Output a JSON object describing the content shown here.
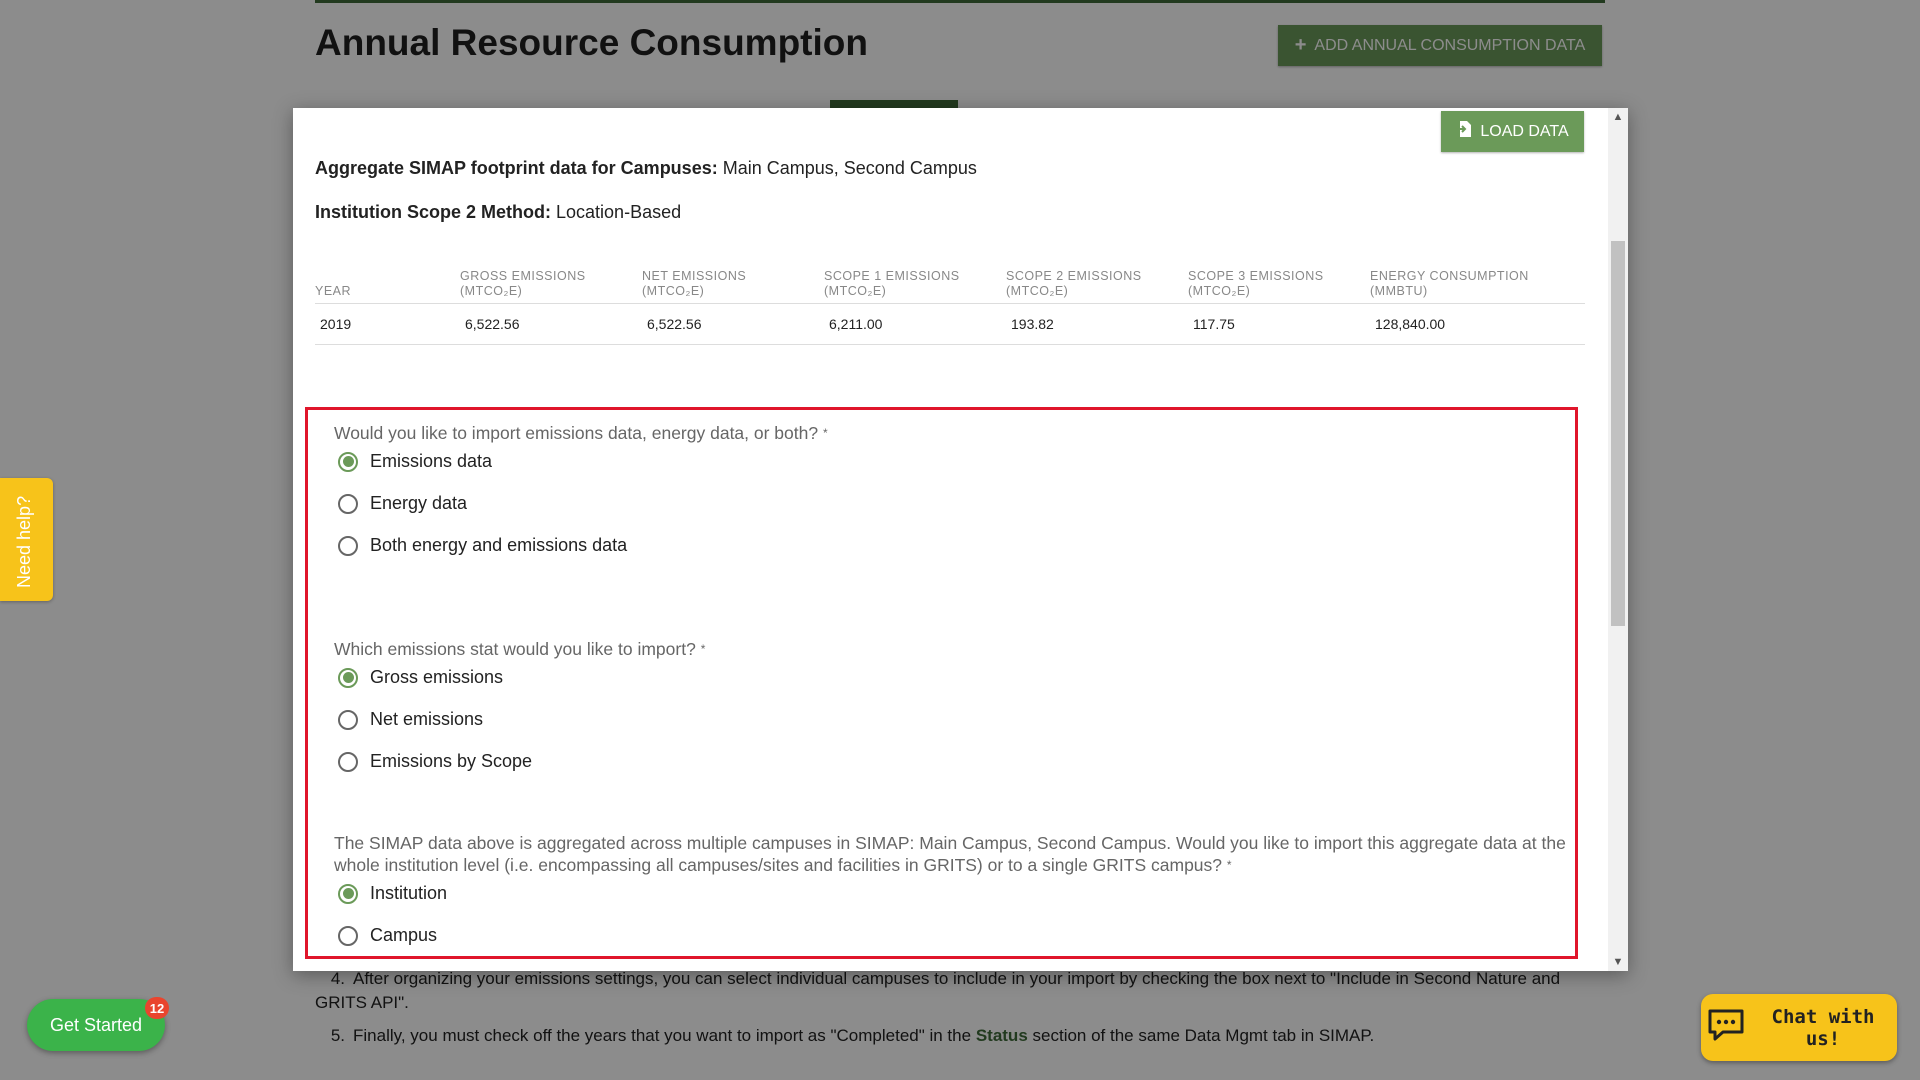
{
  "page": {
    "title": "Annual Resource Consumption",
    "add_button_label": "ADD ANNUAL CONSUMPTION DATA",
    "steps": [
      {
        "num": "4.",
        "text": "After organizing your emissions settings, you can select individual campuses to include in your import by checking the box next to \"Include in Second Nature and GRITS API\"."
      },
      {
        "num": "5.",
        "text_before": "Finally, you must check off the years that you want to import as \"Completed\" in the",
        "link": "Status",
        "text_after": "section of the same Data Mgmt tab in SIMAP."
      }
    ]
  },
  "widgets": {
    "need_help": "Need help?",
    "get_started": "Get Started",
    "get_started_badge": "12",
    "chat": "Chat with us!"
  },
  "modal": {
    "load_button_label": "LOAD DATA",
    "aggregate_label": "Aggregate SIMAP footprint data for Campuses:",
    "aggregate_value": "Main Campus, Second Campus",
    "scope2_label": "Institution Scope 2 Method:",
    "scope2_value": "Location-Based",
    "table": {
      "headers": [
        {
          "line1": "",
          "line2": "YEAR"
        },
        {
          "line1": "GROSS EMISSIONS",
          "line2": "(MTCO₂E)"
        },
        {
          "line1": "NET EMISSIONS",
          "line2": "(MTCO₂E)"
        },
        {
          "line1": "SCOPE 1 EMISSIONS",
          "line2": "(MTCO₂E)"
        },
        {
          "line1": "SCOPE 2 EMISSIONS",
          "line2": "(MTCO₂E)"
        },
        {
          "line1": "SCOPE 3 EMISSIONS",
          "line2": "(MTCO₂E)"
        },
        {
          "line1": "ENERGY CONSUMPTION",
          "line2": "(MMBTU)"
        }
      ],
      "rows": [
        [
          "2019",
          "6,522.56",
          "6,522.56",
          "6,211.00",
          "193.82",
          "117.75",
          "128,840.00"
        ]
      ]
    },
    "questions": [
      {
        "text": "Would you like to import emissions data, energy data, or both?",
        "required": "*",
        "options": [
          {
            "label": "Emissions data",
            "checked": true
          },
          {
            "label": "Energy data",
            "checked": false
          },
          {
            "label": "Both energy and emissions data",
            "checked": false
          }
        ]
      },
      {
        "text": "Which emissions stat would you like to import?",
        "required": "*",
        "options": [
          {
            "label": "Gross emissions",
            "checked": true
          },
          {
            "label": "Net emissions",
            "checked": false
          },
          {
            "label": "Emissions by Scope",
            "checked": false
          }
        ]
      },
      {
        "text": "The SIMAP data above is aggregated across multiple campuses in SIMAP: Main Campus, Second Campus. Would you like to import this aggregate data at the whole institution level (i.e. encompassing all campuses/sites and facilities in GRITS) or to a single GRITS campus?",
        "required": "*",
        "options": [
          {
            "label": "Institution",
            "checked": true
          },
          {
            "label": "Campus",
            "checked": false
          }
        ]
      }
    ]
  },
  "colors": {
    "accent_green": "#6b9a59",
    "dark_green": "#3e6b3a",
    "highlight_red": "#e0162b",
    "widget_yellow": "#f7c31a",
    "get_started_green": "#3bb34a"
  }
}
